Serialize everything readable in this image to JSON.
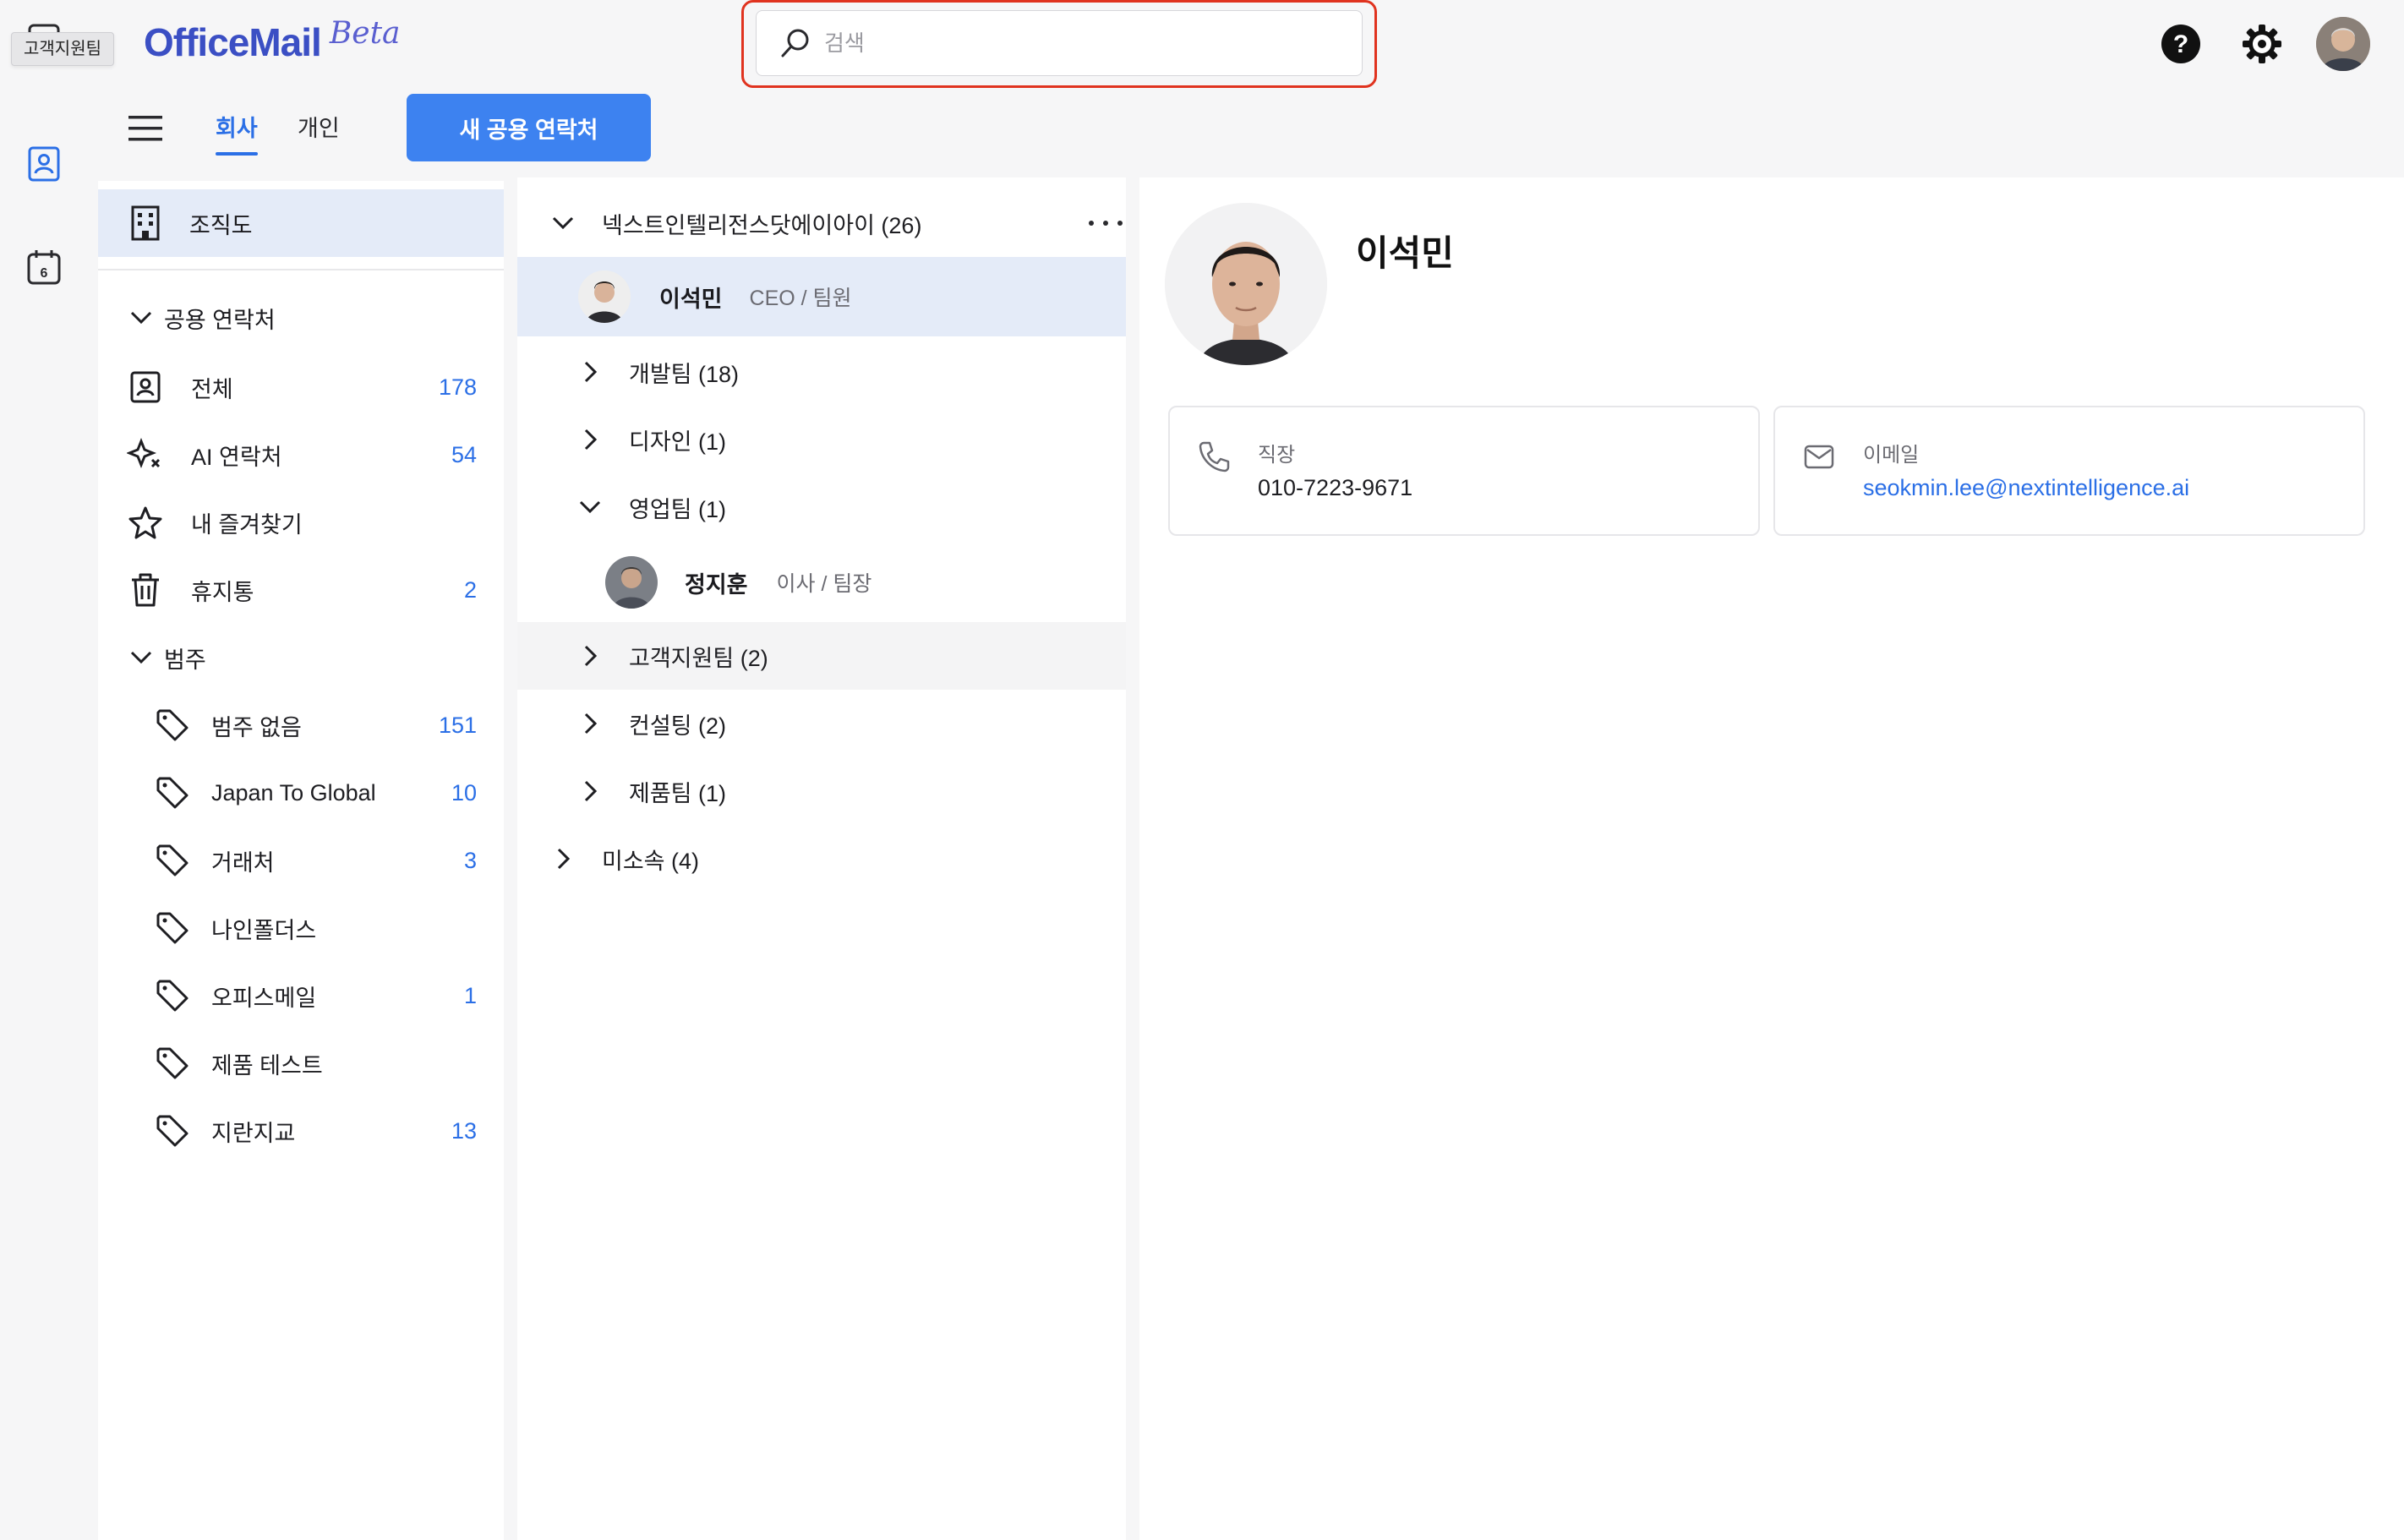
{
  "app": {
    "logo_text": "OfficeMail",
    "logo_beta": "Beta",
    "tooltip": "고객지원팀"
  },
  "search": {
    "placeholder": "검색",
    "value": ""
  },
  "toolbar": {
    "tabs": [
      {
        "label": "회사",
        "active": true
      },
      {
        "label": "개인",
        "active": false
      }
    ],
    "new_button": "새 공용 연락처"
  },
  "sidebar": {
    "org_chart": "조직도",
    "shared_section": "공용 연락처",
    "shared_items": [
      {
        "label": "전체",
        "count": "178",
        "icon": "contact-card-icon"
      },
      {
        "label": "AI 연락처",
        "count": "54",
        "icon": "ai-sparkle-icon"
      },
      {
        "label": "내 즐겨찾기",
        "count": "",
        "icon": "star-icon"
      },
      {
        "label": "휴지통",
        "count": "2",
        "icon": "trash-icon"
      }
    ],
    "category_section": "범주",
    "categories": [
      {
        "label": "범주 없음",
        "count": "151"
      },
      {
        "label": "Japan To Global",
        "count": "10"
      },
      {
        "label": "거래처",
        "count": "3"
      },
      {
        "label": "나인폴더스",
        "count": ""
      },
      {
        "label": "오피스메일",
        "count": "1"
      },
      {
        "label": "제품 테스트",
        "count": ""
      },
      {
        "label": "지란지교",
        "count": "13"
      }
    ]
  },
  "tree": {
    "root": "넥스트인텔리전스닷에이아이 (26)",
    "root_person": {
      "name": "이석민",
      "role": "CEO / 팀원"
    },
    "groups": [
      {
        "label": "개발팀 (18)",
        "expanded": false
      },
      {
        "label": "디자인 (1)",
        "expanded": false
      },
      {
        "label": "영업팀 (1)",
        "expanded": true
      },
      {
        "label": "고객지원팀 (2)",
        "expanded": false
      },
      {
        "label": "컨설팅 (2)",
        "expanded": false
      },
      {
        "label": "제품팀 (1)",
        "expanded": false
      }
    ],
    "sales_person": {
      "name": "정지훈",
      "role": "이사 / 팀장"
    },
    "unassigned": "미소속 (4)"
  },
  "detail": {
    "name": "이석민",
    "phone_label": "직장",
    "phone_value": "010-7223-9671",
    "email_label": "이메일",
    "email_value": "seokmin.lee@nextintelligence.ai"
  },
  "colors": {
    "accent": "#2b6fe6",
    "button": "#3d82f0",
    "selected_row": "#e4ebf8",
    "search_highlight": "#e0331f"
  }
}
